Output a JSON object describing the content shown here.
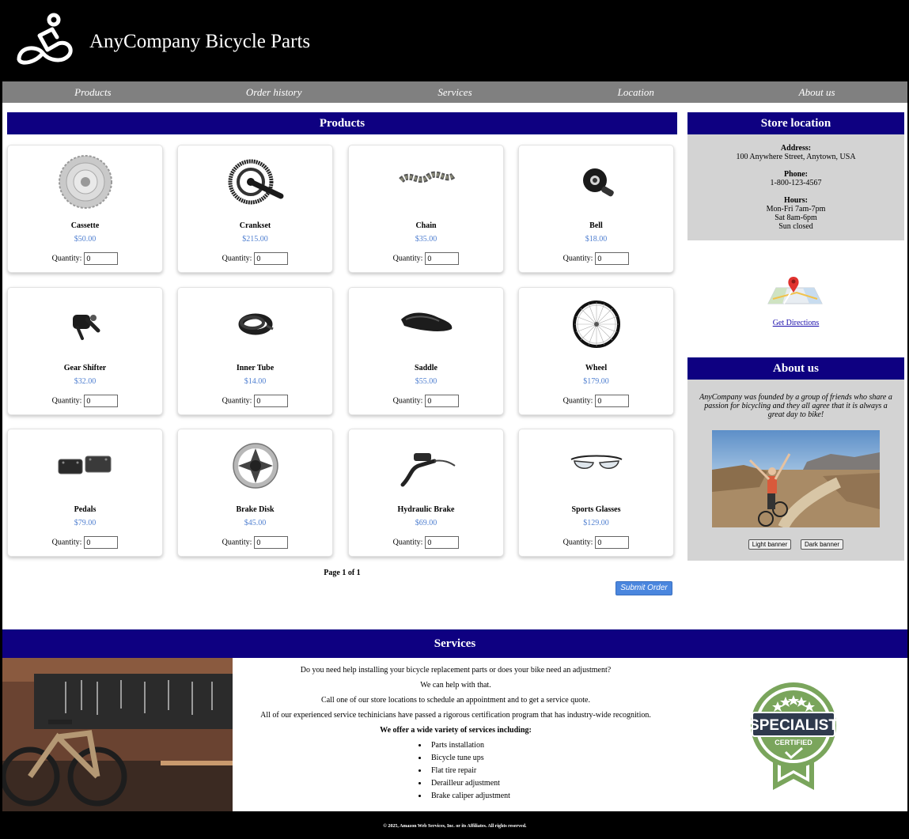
{
  "header": {
    "title": "AnyCompany Bicycle Parts",
    "logo": "cyclist-logo-icon"
  },
  "nav": [
    "Products",
    "Order history",
    "Services",
    "Location",
    "About us"
  ],
  "products": {
    "heading": "Products",
    "quantity_label": "Quantity:",
    "items": [
      {
        "name": "Cassette",
        "price": "$50.00",
        "qty": "0",
        "icon": "cassette-image"
      },
      {
        "name": "Crankset",
        "price": "$215.00",
        "qty": "0",
        "icon": "crankset-image"
      },
      {
        "name": "Chain",
        "price": "$35.00",
        "qty": "0",
        "icon": "chain-image"
      },
      {
        "name": "Bell",
        "price": "$18.00",
        "qty": "0",
        "icon": "bell-image"
      },
      {
        "name": "Gear Shifter",
        "price": "$32.00",
        "qty": "0",
        "icon": "gear-shifter-image"
      },
      {
        "name": "Inner Tube",
        "price": "$14.00",
        "qty": "0",
        "icon": "inner-tube-image"
      },
      {
        "name": "Saddle",
        "price": "$55.00",
        "qty": "0",
        "icon": "saddle-image"
      },
      {
        "name": "Wheel",
        "price": "$179.00",
        "qty": "0",
        "icon": "wheel-image"
      },
      {
        "name": "Pedals",
        "price": "$79.00",
        "qty": "0",
        "icon": "pedals-image"
      },
      {
        "name": "Brake Disk",
        "price": "$45.00",
        "qty": "0",
        "icon": "brake-disk-image"
      },
      {
        "name": "Hydraulic Brake",
        "price": "$69.00",
        "qty": "0",
        "icon": "hydraulic-brake-image"
      },
      {
        "name": "Sports Glasses",
        "price": "$129.00",
        "qty": "0",
        "icon": "sports-glasses-image"
      }
    ],
    "pager": "Page 1 of 1",
    "submit_label": "Submit Order"
  },
  "store": {
    "heading": "Store location",
    "address_label": "Address:",
    "address": "100 Anywhere Street, Anytown, USA",
    "phone_label": "Phone:",
    "phone": "1-800-123-4567",
    "hours_label": "Hours:",
    "hours": [
      "Mon-Fri 7am-7pm",
      "Sat 8am-6pm",
      "Sun closed"
    ],
    "directions_label": "Get Directions"
  },
  "about": {
    "heading": "About us",
    "text": "AnyCompany was founded by a group of friends who share a passion for bicycling and they all agree that it is always a great day to bike!",
    "light_button": "Light banner",
    "dark_button": "Dark banner"
  },
  "services": {
    "heading": "Services",
    "lines": [
      "Do you need help installing your bicycle replacement parts or does your bike need an adjustment?",
      "We can help with that.",
      "Call one of our store locations to schedule an appointment and to get a service quote.",
      "All of our experienced service techinicians have passed a rigorous certification program that has industry-wide recognition."
    ],
    "list_heading": "We offer a wide variety of services including:",
    "list": [
      "Parts installation",
      "Bicycle tune ups",
      "Flat tire repair",
      "Derailleur adjustment",
      "Brake caliper adjustment"
    ],
    "badge_top": "SPECIALIST",
    "badge_bottom": "CERTIFIED"
  },
  "footer": {
    "text": "© 2025, Amazon Web Services, Inc. or its Affiliates. All rights reserved."
  },
  "colors": {
    "section_header": "#0e0081",
    "nav": "#808080",
    "price": "#4f7fd0",
    "panel": "#d3d3d3",
    "badge_green": "#7aa55c"
  }
}
